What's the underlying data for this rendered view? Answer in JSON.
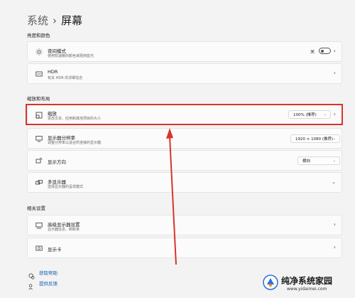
{
  "breadcrumb": {
    "parent": "系统",
    "separator": "›",
    "current": "屏幕"
  },
  "sections": {
    "brightness": "亮度和颜色",
    "scale": "缩放和布局",
    "related": "相关设置"
  },
  "rows": {
    "night": {
      "title": "夜间模式",
      "subtitle": "使用较温暖的颜色来阻挡蓝光",
      "toggle_label": "关"
    },
    "hdr": {
      "title": "HDR",
      "subtitle": "有关 HDR 的详细信息"
    },
    "zoom": {
      "title": "缩放",
      "subtitle": "更改文本、应用和其他项目的大小",
      "value": "100% (推荐)"
    },
    "resolution": {
      "title": "显示器分辨率",
      "subtitle": "调整分辨率以适合所连接的显示器",
      "value": "1920 × 1080 (推荐)"
    },
    "orientation": {
      "title": "显示方向",
      "value": "横向"
    },
    "multi": {
      "title": "多显示器",
      "subtitle": "选择显示器的呈现模式"
    },
    "advanced": {
      "title": "高级显示器设置",
      "subtitle": "显示器信息、刷新率"
    },
    "gpu": {
      "title": "显示卡"
    }
  },
  "footer": {
    "help": "获取帮助",
    "feedback": "提供反馈"
  },
  "watermark": {
    "name": "纯净系统家园",
    "url": "www.yidaimei.com"
  },
  "colors": {
    "accent_red": "#d9342b",
    "link": "#1a5fb4"
  }
}
